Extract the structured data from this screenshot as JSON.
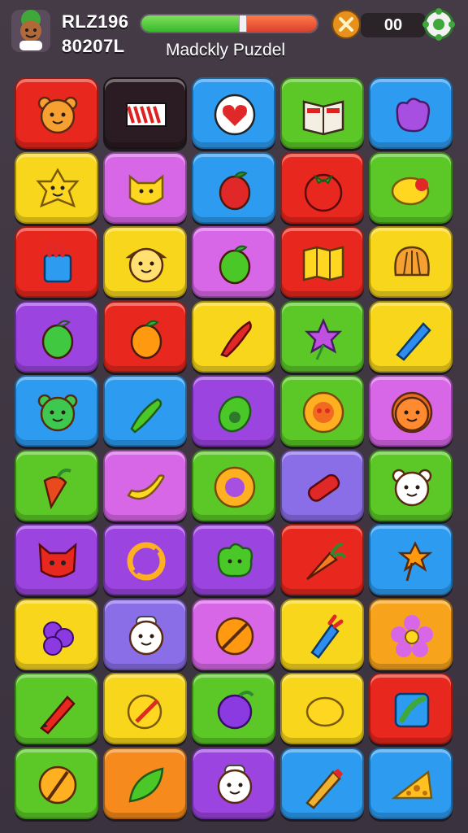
{
  "hud": {
    "player_id": "RLZ196",
    "player_score": "80207L",
    "title": "Madckly Puzdel",
    "progress": 0.58,
    "counter": "00",
    "avatar_icon": "avatar-icon",
    "coin_icon": "coin-icon",
    "settings_icon": "gear-icon"
  },
  "board": {
    "cols": 5,
    "rows": 10,
    "tiles": [
      {
        "color": "#e8281e",
        "icon": "bear-face"
      },
      {
        "color": "#2a1c22",
        "icon": "flag"
      },
      {
        "color": "#2d9cf0",
        "icon": "heart-badge"
      },
      {
        "color": "#5cc828",
        "icon": "book"
      },
      {
        "color": "#2d9cf0",
        "icon": "purple-blob"
      },
      {
        "color": "#f7d61c",
        "icon": "star-face"
      },
      {
        "color": "#d867e8",
        "icon": "cat-face"
      },
      {
        "color": "#2d9cf0",
        "icon": "strawberry"
      },
      {
        "color": "#e8281e",
        "icon": "tomato"
      },
      {
        "color": "#5cc828",
        "icon": "lemon"
      },
      {
        "color": "#e8281e",
        "icon": "jar"
      },
      {
        "color": "#f7d61c",
        "icon": "bear-hat"
      },
      {
        "color": "#d867e8",
        "icon": "pear"
      },
      {
        "color": "#e8281e",
        "icon": "map"
      },
      {
        "color": "#f7d61c",
        "icon": "shell"
      },
      {
        "color": "#9b44e0",
        "icon": "bow-fruit"
      },
      {
        "color": "#e8281e",
        "icon": "apple"
      },
      {
        "color": "#f7d61c",
        "icon": "pepper"
      },
      {
        "color": "#5cc828",
        "icon": "star-flower"
      },
      {
        "color": "#f7d61c",
        "icon": "crayon"
      },
      {
        "color": "#2d9cf0",
        "icon": "green-bear"
      },
      {
        "color": "#2d9cf0",
        "icon": "chili"
      },
      {
        "color": "#9b44e0",
        "icon": "avocado"
      },
      {
        "color": "#5cc828",
        "icon": "sunflower"
      },
      {
        "color": "#d867e8",
        "icon": "lion"
      },
      {
        "color": "#5cc828",
        "icon": "carrot-small"
      },
      {
        "color": "#d867e8",
        "icon": "banana"
      },
      {
        "color": "#5cc828",
        "icon": "purple-flower"
      },
      {
        "color": "#8a6ee8",
        "icon": "tube"
      },
      {
        "color": "#5cc828",
        "icon": "polar-bear"
      },
      {
        "color": "#9b44e0",
        "icon": "devil-cat"
      },
      {
        "color": "#9b44e0",
        "icon": "no-sign"
      },
      {
        "color": "#9b44e0",
        "icon": "green-blob"
      },
      {
        "color": "#e8281e",
        "icon": "carrot"
      },
      {
        "color": "#2d9cf0",
        "icon": "star-wand"
      },
      {
        "color": "#f7d61c",
        "icon": "grapes"
      },
      {
        "color": "#8a6ee8",
        "icon": "chef-bear"
      },
      {
        "color": "#d867e8",
        "icon": "orange-slash"
      },
      {
        "color": "#f7d61c",
        "icon": "fries"
      },
      {
        "color": "#f7a41c",
        "icon": "pink-flower"
      },
      {
        "color": "#5cc828",
        "icon": "pencil"
      },
      {
        "color": "#f7d61c",
        "icon": "lemon-slice"
      },
      {
        "color": "#5cc828",
        "icon": "berries"
      },
      {
        "color": "#f7d61c",
        "icon": "lemon-big"
      },
      {
        "color": "#e8281e",
        "icon": "blue-box"
      },
      {
        "color": "#5cc828",
        "icon": "orange-ring"
      },
      {
        "color": "#f78a1c",
        "icon": "leaf"
      },
      {
        "color": "#9b44e0",
        "icon": "chef-bear-2"
      },
      {
        "color": "#2d9cf0",
        "icon": "pencil-2"
      },
      {
        "color": "#2d9cf0",
        "icon": "cheese"
      }
    ]
  }
}
